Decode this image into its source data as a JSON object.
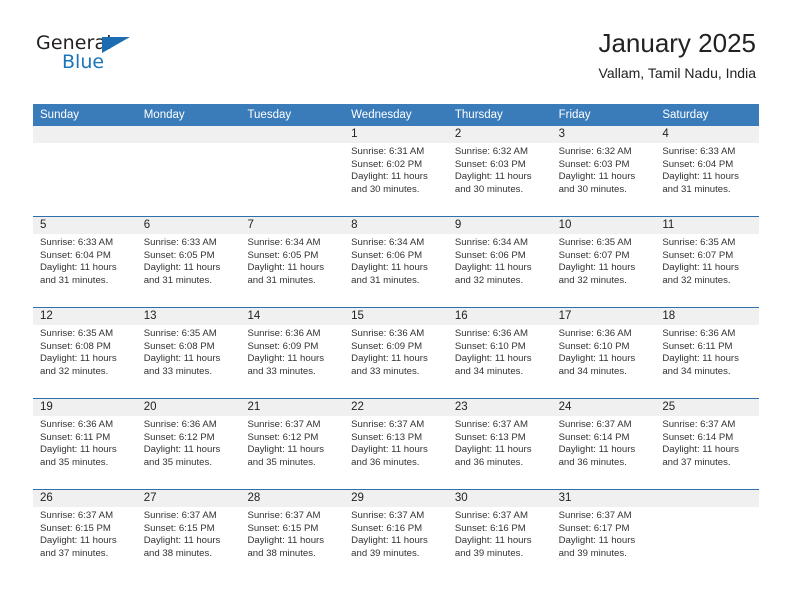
{
  "brand": {
    "word_one": "General",
    "word_two": "Blue",
    "flag_icon": "triangle-flag-icon"
  },
  "header": {
    "title": "January 2025",
    "location": "Vallam, Tamil Nadu, India"
  },
  "colors": {
    "header_blue": "#3a7cba",
    "rule_blue": "#2f6fae",
    "daynum_bg": "#f0f0f0",
    "brand_blue": "#1b75bb"
  },
  "weekdays": [
    "Sunday",
    "Monday",
    "Tuesday",
    "Wednesday",
    "Thursday",
    "Friday",
    "Saturday"
  ],
  "weeks": [
    [
      {
        "day": "",
        "sunrise": "",
        "sunset": "",
        "daylight_line1": "",
        "daylight_line2": ""
      },
      {
        "day": "",
        "sunrise": "",
        "sunset": "",
        "daylight_line1": "",
        "daylight_line2": ""
      },
      {
        "day": "",
        "sunrise": "",
        "sunset": "",
        "daylight_line1": "",
        "daylight_line2": ""
      },
      {
        "day": "1",
        "sunrise": "Sunrise: 6:31 AM",
        "sunset": "Sunset: 6:02 PM",
        "daylight_line1": "Daylight: 11 hours",
        "daylight_line2": "and 30 minutes."
      },
      {
        "day": "2",
        "sunrise": "Sunrise: 6:32 AM",
        "sunset": "Sunset: 6:03 PM",
        "daylight_line1": "Daylight: 11 hours",
        "daylight_line2": "and 30 minutes."
      },
      {
        "day": "3",
        "sunrise": "Sunrise: 6:32 AM",
        "sunset": "Sunset: 6:03 PM",
        "daylight_line1": "Daylight: 11 hours",
        "daylight_line2": "and 30 minutes."
      },
      {
        "day": "4",
        "sunrise": "Sunrise: 6:33 AM",
        "sunset": "Sunset: 6:04 PM",
        "daylight_line1": "Daylight: 11 hours",
        "daylight_line2": "and 31 minutes."
      }
    ],
    [
      {
        "day": "5",
        "sunrise": "Sunrise: 6:33 AM",
        "sunset": "Sunset: 6:04 PM",
        "daylight_line1": "Daylight: 11 hours",
        "daylight_line2": "and 31 minutes."
      },
      {
        "day": "6",
        "sunrise": "Sunrise: 6:33 AM",
        "sunset": "Sunset: 6:05 PM",
        "daylight_line1": "Daylight: 11 hours",
        "daylight_line2": "and 31 minutes."
      },
      {
        "day": "7",
        "sunrise": "Sunrise: 6:34 AM",
        "sunset": "Sunset: 6:05 PM",
        "daylight_line1": "Daylight: 11 hours",
        "daylight_line2": "and 31 minutes."
      },
      {
        "day": "8",
        "sunrise": "Sunrise: 6:34 AM",
        "sunset": "Sunset: 6:06 PM",
        "daylight_line1": "Daylight: 11 hours",
        "daylight_line2": "and 31 minutes."
      },
      {
        "day": "9",
        "sunrise": "Sunrise: 6:34 AM",
        "sunset": "Sunset: 6:06 PM",
        "daylight_line1": "Daylight: 11 hours",
        "daylight_line2": "and 32 minutes."
      },
      {
        "day": "10",
        "sunrise": "Sunrise: 6:35 AM",
        "sunset": "Sunset: 6:07 PM",
        "daylight_line1": "Daylight: 11 hours",
        "daylight_line2": "and 32 minutes."
      },
      {
        "day": "11",
        "sunrise": "Sunrise: 6:35 AM",
        "sunset": "Sunset: 6:07 PM",
        "daylight_line1": "Daylight: 11 hours",
        "daylight_line2": "and 32 minutes."
      }
    ],
    [
      {
        "day": "12",
        "sunrise": "Sunrise: 6:35 AM",
        "sunset": "Sunset: 6:08 PM",
        "daylight_line1": "Daylight: 11 hours",
        "daylight_line2": "and 32 minutes."
      },
      {
        "day": "13",
        "sunrise": "Sunrise: 6:35 AM",
        "sunset": "Sunset: 6:08 PM",
        "daylight_line1": "Daylight: 11 hours",
        "daylight_line2": "and 33 minutes."
      },
      {
        "day": "14",
        "sunrise": "Sunrise: 6:36 AM",
        "sunset": "Sunset: 6:09 PM",
        "daylight_line1": "Daylight: 11 hours",
        "daylight_line2": "and 33 minutes."
      },
      {
        "day": "15",
        "sunrise": "Sunrise: 6:36 AM",
        "sunset": "Sunset: 6:09 PM",
        "daylight_line1": "Daylight: 11 hours",
        "daylight_line2": "and 33 minutes."
      },
      {
        "day": "16",
        "sunrise": "Sunrise: 6:36 AM",
        "sunset": "Sunset: 6:10 PM",
        "daylight_line1": "Daylight: 11 hours",
        "daylight_line2": "and 34 minutes."
      },
      {
        "day": "17",
        "sunrise": "Sunrise: 6:36 AM",
        "sunset": "Sunset: 6:10 PM",
        "daylight_line1": "Daylight: 11 hours",
        "daylight_line2": "and 34 minutes."
      },
      {
        "day": "18",
        "sunrise": "Sunrise: 6:36 AM",
        "sunset": "Sunset: 6:11 PM",
        "daylight_line1": "Daylight: 11 hours",
        "daylight_line2": "and 34 minutes."
      }
    ],
    [
      {
        "day": "19",
        "sunrise": "Sunrise: 6:36 AM",
        "sunset": "Sunset: 6:11 PM",
        "daylight_line1": "Daylight: 11 hours",
        "daylight_line2": "and 35 minutes."
      },
      {
        "day": "20",
        "sunrise": "Sunrise: 6:36 AM",
        "sunset": "Sunset: 6:12 PM",
        "daylight_line1": "Daylight: 11 hours",
        "daylight_line2": "and 35 minutes."
      },
      {
        "day": "21",
        "sunrise": "Sunrise: 6:37 AM",
        "sunset": "Sunset: 6:12 PM",
        "daylight_line1": "Daylight: 11 hours",
        "daylight_line2": "and 35 minutes."
      },
      {
        "day": "22",
        "sunrise": "Sunrise: 6:37 AM",
        "sunset": "Sunset: 6:13 PM",
        "daylight_line1": "Daylight: 11 hours",
        "daylight_line2": "and 36 minutes."
      },
      {
        "day": "23",
        "sunrise": "Sunrise: 6:37 AM",
        "sunset": "Sunset: 6:13 PM",
        "daylight_line1": "Daylight: 11 hours",
        "daylight_line2": "and 36 minutes."
      },
      {
        "day": "24",
        "sunrise": "Sunrise: 6:37 AM",
        "sunset": "Sunset: 6:14 PM",
        "daylight_line1": "Daylight: 11 hours",
        "daylight_line2": "and 36 minutes."
      },
      {
        "day": "25",
        "sunrise": "Sunrise: 6:37 AM",
        "sunset": "Sunset: 6:14 PM",
        "daylight_line1": "Daylight: 11 hours",
        "daylight_line2": "and 37 minutes."
      }
    ],
    [
      {
        "day": "26",
        "sunrise": "Sunrise: 6:37 AM",
        "sunset": "Sunset: 6:15 PM",
        "daylight_line1": "Daylight: 11 hours",
        "daylight_line2": "and 37 minutes."
      },
      {
        "day": "27",
        "sunrise": "Sunrise: 6:37 AM",
        "sunset": "Sunset: 6:15 PM",
        "daylight_line1": "Daylight: 11 hours",
        "daylight_line2": "and 38 minutes."
      },
      {
        "day": "28",
        "sunrise": "Sunrise: 6:37 AM",
        "sunset": "Sunset: 6:15 PM",
        "daylight_line1": "Daylight: 11 hours",
        "daylight_line2": "and 38 minutes."
      },
      {
        "day": "29",
        "sunrise": "Sunrise: 6:37 AM",
        "sunset": "Sunset: 6:16 PM",
        "daylight_line1": "Daylight: 11 hours",
        "daylight_line2": "and 39 minutes."
      },
      {
        "day": "30",
        "sunrise": "Sunrise: 6:37 AM",
        "sunset": "Sunset: 6:16 PM",
        "daylight_line1": "Daylight: 11 hours",
        "daylight_line2": "and 39 minutes."
      },
      {
        "day": "31",
        "sunrise": "Sunrise: 6:37 AM",
        "sunset": "Sunset: 6:17 PM",
        "daylight_line1": "Daylight: 11 hours",
        "daylight_line2": "and 39 minutes."
      },
      {
        "day": "",
        "sunrise": "",
        "sunset": "",
        "daylight_line1": "",
        "daylight_line2": ""
      }
    ]
  ]
}
